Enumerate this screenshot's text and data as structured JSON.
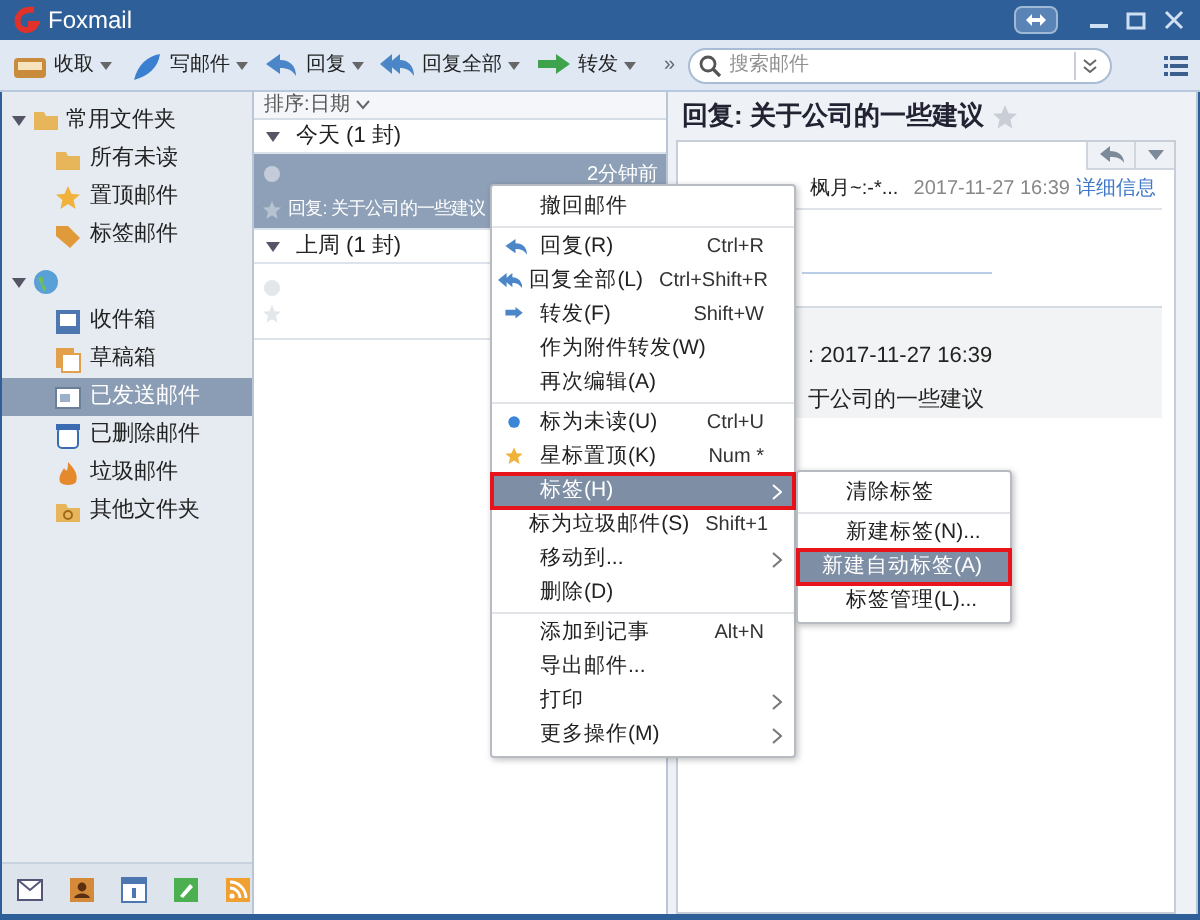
{
  "window": {
    "title": "Foxmail"
  },
  "toolbar": {
    "buttons": [
      {
        "label": "收取"
      },
      {
        "label": "写邮件"
      },
      {
        "label": "回复"
      },
      {
        "label": "回复全部"
      },
      {
        "label": "转发"
      }
    ],
    "more": "»",
    "search": {
      "placeholder": "搜索邮件"
    }
  },
  "sidebar": {
    "groups": [
      {
        "label": "常用文件夹",
        "expanded": true,
        "children": [
          {
            "label": "所有未读",
            "selected": false
          },
          {
            "label": "置顶邮件",
            "selected": false
          },
          {
            "label": "标签邮件",
            "selected": false
          }
        ]
      },
      {
        "expanded": true,
        "children": [
          {
            "label": "收件箱",
            "selected": false
          },
          {
            "label": "草稿箱",
            "selected": false
          },
          {
            "label": "已发送邮件",
            "selected": true
          },
          {
            "label": "已删除邮件",
            "selected": false
          },
          {
            "label": "垃圾邮件",
            "selected": false
          },
          {
            "label": "其他文件夹",
            "selected": false
          }
        ]
      }
    ]
  },
  "message_list": {
    "sort": "排序:日期",
    "groups": [
      {
        "label": "今天 (1 封)",
        "expanded": true,
        "messages": [
          {
            "time": "2分钟前",
            "subject": "回复: 关于公司的一些建议",
            "selected": true
          }
        ]
      },
      {
        "label": "上周 (1 封)",
        "expanded": true,
        "messages": [
          {
            "selected": false
          }
        ]
      }
    ]
  },
  "reader": {
    "subject": "回复: 关于公司的一些建议",
    "sender": "枫月~:-*...",
    "date": "2017-11-27 16:39",
    "details_link": "详细信息",
    "quote_date": ": 2017-11-27 16:39",
    "quote_subject": "于公司的一些建议"
  },
  "context_menu": {
    "items": [
      {
        "kind": "item",
        "label": "撤回邮件",
        "highlighted": false,
        "submenu": false
      },
      {
        "kind": "separator"
      },
      {
        "kind": "item",
        "label": "回复(R)",
        "shortcut": "Ctrl+R",
        "highlighted": false,
        "submenu": false
      },
      {
        "kind": "item",
        "label": "回复全部(L)",
        "shortcut": "Ctrl+Shift+R",
        "highlighted": false,
        "submenu": false
      },
      {
        "kind": "item",
        "label": "转发(F)",
        "shortcut": "Shift+W",
        "highlighted": false,
        "submenu": false
      },
      {
        "kind": "item",
        "label": "作为附件转发(W)",
        "highlighted": false,
        "submenu": false
      },
      {
        "kind": "item",
        "label": "再次编辑(A)",
        "highlighted": false,
        "submenu": false
      },
      {
        "kind": "separator"
      },
      {
        "kind": "item",
        "label": "标为未读(U)",
        "shortcut": "Ctrl+U",
        "highlighted": false,
        "submenu": false
      },
      {
        "kind": "item",
        "label": "星标置顶(K)",
        "shortcut": "Num *",
        "highlighted": false,
        "submenu": false
      },
      {
        "kind": "item",
        "label": "标签(H)",
        "highlighted": true,
        "submenu": true
      },
      {
        "kind": "item",
        "label": "标为垃圾邮件(S)",
        "shortcut": "Shift+1",
        "highlighted": false,
        "submenu": false
      },
      {
        "kind": "item",
        "label": "移动到...",
        "highlighted": false,
        "submenu": true
      },
      {
        "kind": "item",
        "label": "删除(D)",
        "highlighted": false,
        "submenu": false
      },
      {
        "kind": "separator"
      },
      {
        "kind": "item",
        "label": "添加到记事",
        "shortcut": "Alt+N",
        "highlighted": false,
        "submenu": false
      },
      {
        "kind": "item",
        "label": "导出邮件...",
        "highlighted": false,
        "submenu": false
      },
      {
        "kind": "item",
        "label": "打印",
        "highlighted": false,
        "submenu": true
      },
      {
        "kind": "item",
        "label": "更多操作(M)",
        "highlighted": false,
        "submenu": true
      }
    ]
  },
  "submenu": {
    "items": [
      {
        "kind": "item",
        "label": "清除标签",
        "highlighted": false
      },
      {
        "kind": "separator"
      },
      {
        "kind": "item",
        "label": "新建标签(N)...",
        "highlighted": false
      },
      {
        "kind": "item",
        "label": "新建自动标签(A)",
        "highlighted": true
      },
      {
        "kind": "item",
        "label": "标签管理(L)...",
        "highlighted": false
      }
    ]
  }
}
